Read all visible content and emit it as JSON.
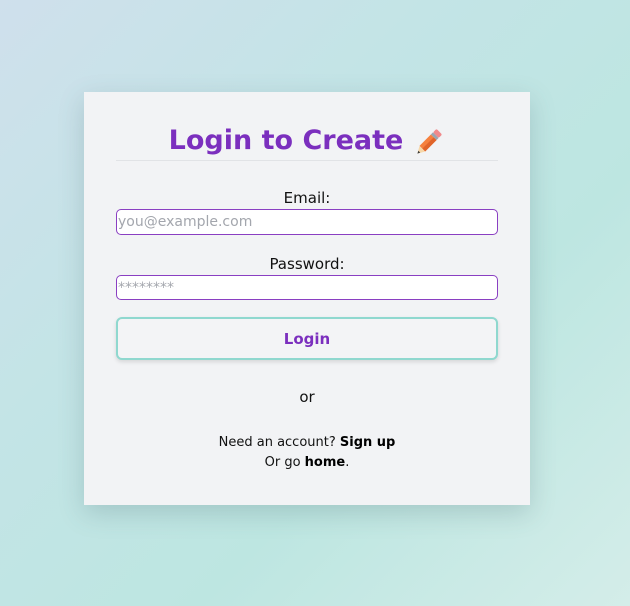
{
  "login_card": {
    "title": "Login to Create",
    "title_icon": "pencil-icon",
    "email_label": "Email:",
    "email_placeholder": "you@example.com",
    "email_value": "",
    "password_label": "Password:",
    "password_placeholder": "********",
    "password_value": "",
    "login_button_label": "Login",
    "or_text": "or",
    "signup_prompt": "Need an account? ",
    "signup_link": "Sign up",
    "home_prompt": "Or go ",
    "home_link": "home",
    "home_suffix": "."
  },
  "colors": {
    "accent_purple": "#7b2fbe",
    "button_border_teal": "#8fd8cf",
    "card_background": "#f2f3f5"
  }
}
